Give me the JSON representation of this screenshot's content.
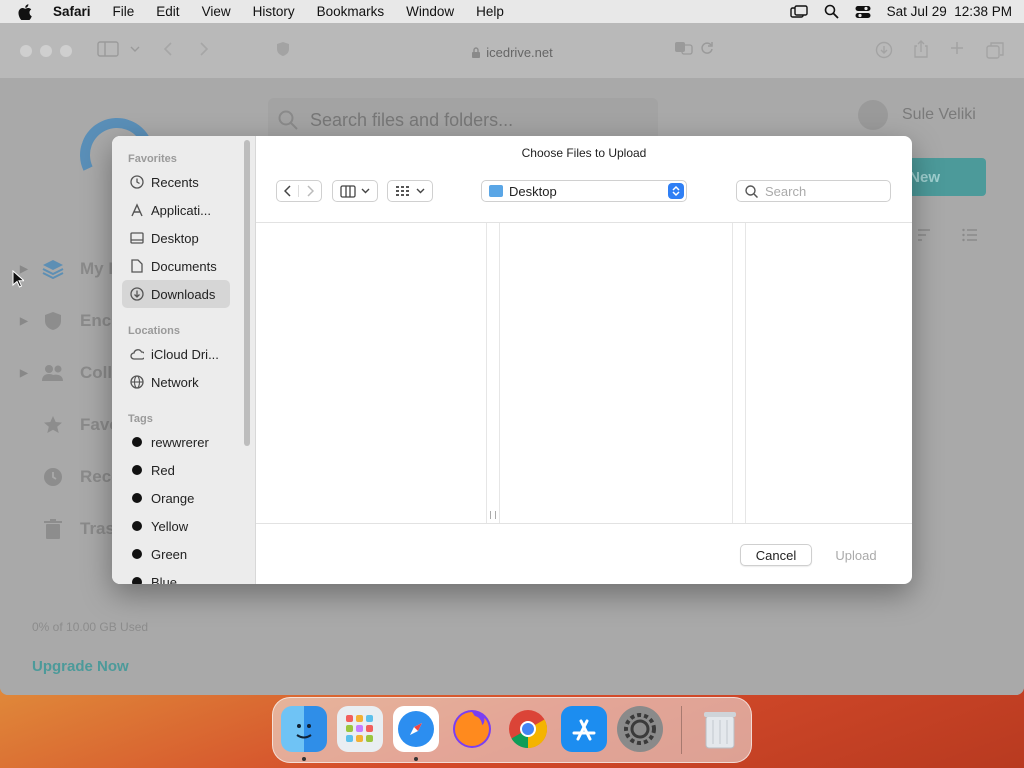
{
  "menubar": {
    "app_name": "Safari",
    "menus": [
      "File",
      "Edit",
      "View",
      "History",
      "Bookmarks",
      "Window",
      "Help"
    ],
    "datetime": "Sat Jul 29  12:38 PM"
  },
  "browser": {
    "url": "icedrive.net"
  },
  "page": {
    "search_placeholder": "Search files and folders...",
    "user_name": "Sule Veliki",
    "new_button": "New",
    "nav": [
      "My I",
      "Encr",
      "Coll",
      "Favo",
      "Rece",
      "Tras"
    ],
    "storage_text": "0% of 10.00 GB Used",
    "upgrade_link": "Upgrade Now"
  },
  "dialog": {
    "title": "Choose Files to Upload",
    "location": "Desktop",
    "search_placeholder": "Search",
    "favorites_heading": "Favorites",
    "favorites": [
      "Recents",
      "Applicati...",
      "Desktop",
      "Documents",
      "Downloads"
    ],
    "selected_favorite": "Downloads",
    "locations_heading": "Locations",
    "locations": [
      "iCloud Dri...",
      "Network"
    ],
    "tags_heading": "Tags",
    "tags": [
      "rewwrerer",
      "Red",
      "Orange",
      "Yellow",
      "Green",
      "Blue"
    ],
    "cancel_label": "Cancel",
    "upload_label": "Upload"
  },
  "colors": {
    "accent": "#2f7ff5",
    "brand_teal": "#4c9a9a"
  }
}
